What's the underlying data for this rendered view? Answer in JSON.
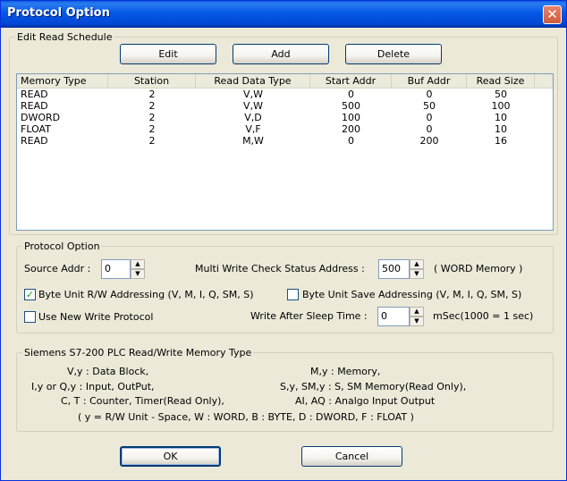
{
  "window": {
    "title": "Protocol Option",
    "close_glyph": "✕"
  },
  "schedule": {
    "group_label": "Edit Read Schedule",
    "buttons": {
      "edit": "Edit",
      "add": "Add",
      "delete": "Delete"
    },
    "columns": [
      "Memory Type",
      "Station",
      "Read Data Type",
      "Start Addr",
      "Buf Addr",
      "Read Size"
    ],
    "rows": [
      [
        "READ",
        "2",
        "V,W",
        "0",
        "0",
        "50"
      ],
      [
        "READ",
        "2",
        "V,W",
        "500",
        "50",
        "100"
      ],
      [
        "DWORD",
        "2",
        "V,D",
        "100",
        "0",
        "10"
      ],
      [
        "FLOAT",
        "2",
        "V,F",
        "200",
        "0",
        "10"
      ],
      [
        "READ",
        "2",
        "M,W",
        "0",
        "200",
        "16"
      ]
    ]
  },
  "protocol": {
    "group_label": "Protocol Option",
    "source_addr_label": "Source Addr :",
    "source_addr_value": "0",
    "multi_write_label": "Multi Write Check Status Address :",
    "multi_write_value": "500",
    "word_memory_label": "( WORD Memory )",
    "byte_unit_rw_label": "Byte Unit R/W Addressing (V, M, I, Q, SM, S)",
    "byte_unit_rw_checked": true,
    "byte_unit_save_label": "Byte Unit Save Addressing (V, M, I, Q, SM, S)",
    "byte_unit_save_checked": false,
    "new_write_label": "Use New Write Protocol",
    "new_write_checked": false,
    "sleep_label": "Write After Sleep Time :",
    "sleep_value": "0",
    "sleep_unit": "mSec(1000 = 1 sec)"
  },
  "memory_type": {
    "group_label": "Siemens S7-200 PLC Read/Write Memory Type",
    "left_lines": [
      "V,y : Data Block,",
      "I,y or Q,y : Input, OutPut,",
      "C, T : Counter, Timer(Read Only),"
    ],
    "right_lines": [
      "M,y : Memory,",
      "S,y, SM,y : S, SM Memory(Read Only),",
      "AI, AQ : Analgo Input Output"
    ],
    "footer": "( y = R/W Unit - Space, W : WORD, B : BYTE, D : DWORD, F : FLOAT )"
  },
  "footer": {
    "ok": "OK",
    "cancel": "Cancel"
  }
}
